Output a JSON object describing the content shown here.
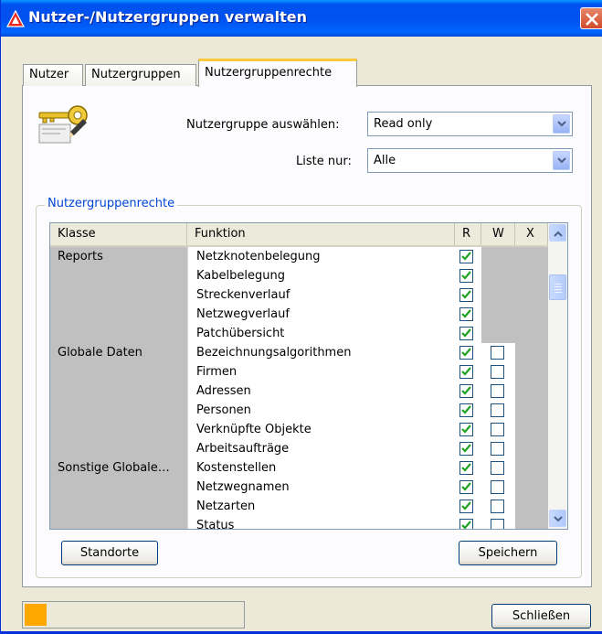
{
  "window": {
    "title": "Nutzer-/Nutzergruppen verwalten",
    "close_icon": "close-icon",
    "app_icon": "app-logo-icon",
    "accent": "#0054e3"
  },
  "tabs": [
    {
      "label": "Nutzer"
    },
    {
      "label": "Nutzergruppen"
    },
    {
      "label": "Nutzergruppenrechte"
    }
  ],
  "form": {
    "icon": "key-pencil-icon",
    "group_label": "Nutzergruppe auswählen:",
    "group_value": "Read only",
    "list_label": "Liste nur:",
    "list_value": "Alle"
  },
  "rights": {
    "title": "Nutzergruppenrechte",
    "headers": {
      "klasse": "Klasse",
      "funktion": "Funktion",
      "r": "R",
      "w": "W",
      "x": "X"
    },
    "rows": [
      {
        "klasse": "Reports",
        "funktion": "Netzknotenbelegung",
        "r": true,
        "w": null
      },
      {
        "klasse": "",
        "funktion": "Kabelbelegung",
        "r": true,
        "w": null
      },
      {
        "klasse": "",
        "funktion": "Streckenverlauf",
        "r": true,
        "w": null
      },
      {
        "klasse": "",
        "funktion": "Netzwegverlauf",
        "r": true,
        "w": null
      },
      {
        "klasse": "",
        "funktion": "Patchübersicht",
        "r": true,
        "w": null
      },
      {
        "klasse": "Globale Daten",
        "funktion": "Bezeichnungsalgorithmen",
        "r": true,
        "w": false
      },
      {
        "klasse": "",
        "funktion": "Firmen",
        "r": true,
        "w": false
      },
      {
        "klasse": "",
        "funktion": "Adressen",
        "r": true,
        "w": false
      },
      {
        "klasse": "",
        "funktion": "Personen",
        "r": true,
        "w": false
      },
      {
        "klasse": "",
        "funktion": "Verknüpfte Objekte",
        "r": true,
        "w": false
      },
      {
        "klasse": "",
        "funktion": "Arbeitsaufträge",
        "r": true,
        "w": false
      },
      {
        "klasse": "Sonstige Globale…",
        "funktion": "Kostenstellen",
        "r": true,
        "w": false
      },
      {
        "klasse": "",
        "funktion": "Netzwegnamen",
        "r": true,
        "w": false
      },
      {
        "klasse": "",
        "funktion": "Netzarten",
        "r": true,
        "w": false
      },
      {
        "klasse": "",
        "funktion": "Status",
        "r": true,
        "w": false
      }
    ]
  },
  "buttons": {
    "standorte": "Standorte",
    "speichern": "Speichern",
    "schliessen": "Schließen"
  },
  "status": {
    "indicator_color": "#ffa800"
  }
}
